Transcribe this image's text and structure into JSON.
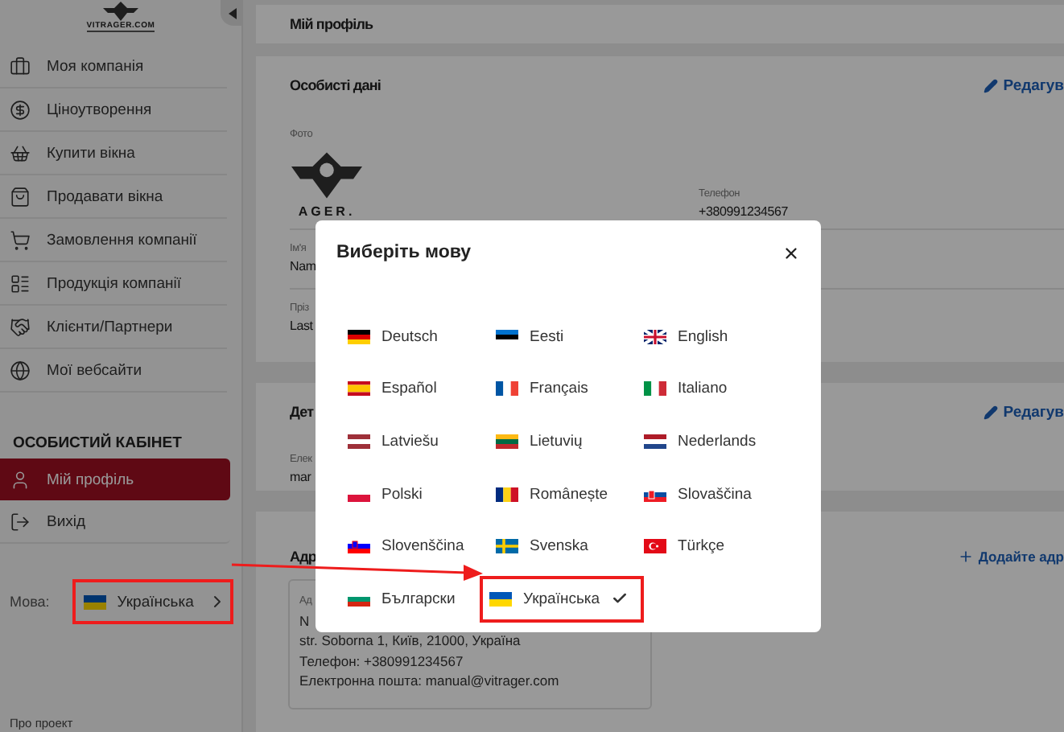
{
  "sidebar": {
    "logo_text": "VITRAGER.COM",
    "menu": [
      {
        "label": "Моя компанія"
      },
      {
        "label": "Ціноутворення"
      },
      {
        "label": "Купити вікна"
      },
      {
        "label": "Продавати вікна"
      },
      {
        "label": "Замовлення компанії"
      },
      {
        "label": "Продукція компанії"
      },
      {
        "label": "Клієнти/Партнери"
      },
      {
        "label": "Мої вебсайти"
      }
    ],
    "section_title": "ОСОБИСТИЙ КАБІНЕТ",
    "account_items": [
      {
        "label": "Мій профіль",
        "selected": true
      },
      {
        "label": "Вихід",
        "selected": false
      }
    ],
    "language": {
      "label": "Мова:",
      "value": "Українська",
      "highlighted": true
    },
    "footer_link": "Про проект"
  },
  "page_title": "Мій профіль",
  "personal": {
    "title": "Особисті дані",
    "edit": "Редагув",
    "photo_label": "Фото",
    "logo_text": "AGER.",
    "phone_label": "Телефон",
    "phone": "+380991234567",
    "fields": [
      {
        "label": "Ім'я",
        "value": "Nam"
      },
      {
        "label": "Пріз",
        "value": "Last"
      }
    ]
  },
  "details": {
    "title": "Дет",
    "edit": "Редагув",
    "label": "Елек",
    "value": "mar"
  },
  "addresses": {
    "title": "Адр",
    "add": "Додайте адр",
    "card_label": "Ад",
    "lines": [
      "N",
      "str. Soborna 1, Київ, 21000, Україна",
      "Телефон: +380991234567",
      "Електронна пошта: manual@vitrager.com"
    ]
  },
  "modal": {
    "title": "Виберіть мову",
    "languages": [
      {
        "label": "Deutsch",
        "selected": false
      },
      {
        "label": "Eesti",
        "selected": false
      },
      {
        "label": "English",
        "selected": false
      },
      {
        "label": "Español",
        "selected": false
      },
      {
        "label": "Français",
        "selected": false
      },
      {
        "label": "Italiano",
        "selected": false
      },
      {
        "label": "Latviešu",
        "selected": false
      },
      {
        "label": "Lietuvių",
        "selected": false
      },
      {
        "label": "Nederlands",
        "selected": false
      },
      {
        "label": "Polski",
        "selected": false
      },
      {
        "label": "Românește",
        "selected": false
      },
      {
        "label": "Slovaščina",
        "selected": false
      },
      {
        "label": "Slovenščina",
        "selected": false
      },
      {
        "label": "Svenska",
        "selected": false
      },
      {
        "label": "Türkçe",
        "selected": false
      },
      {
        "label": "Български",
        "selected": false
      },
      {
        "label": "Українська",
        "selected": true
      }
    ]
  }
}
